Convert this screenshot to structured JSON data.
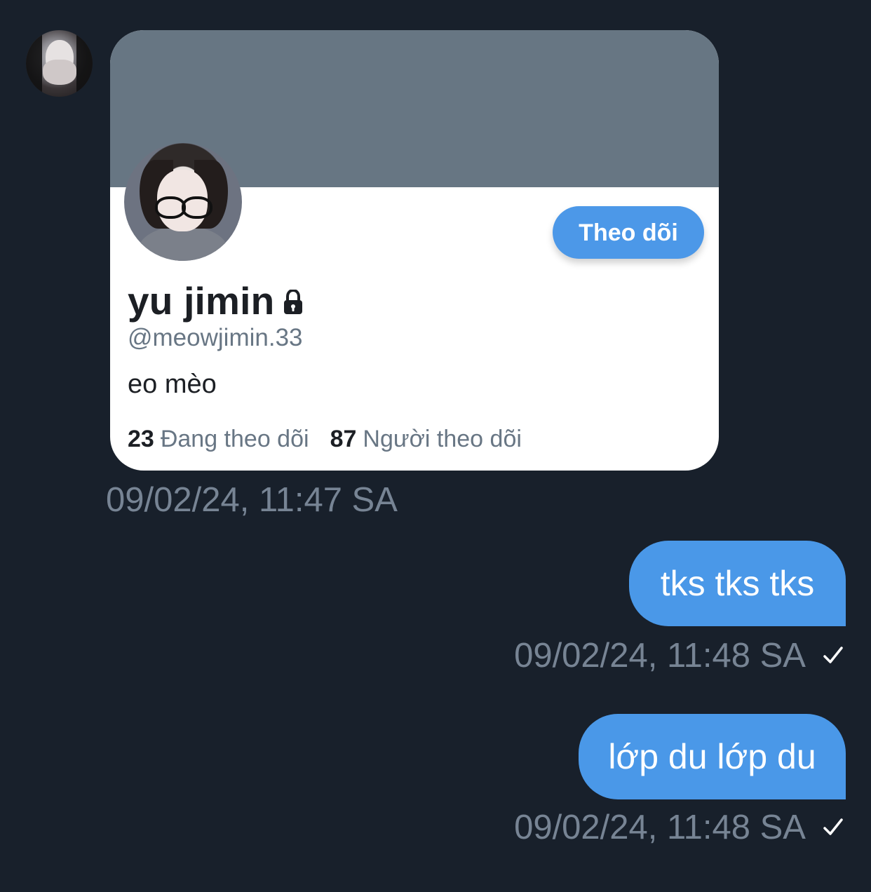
{
  "card": {
    "follow_label": "Theo dõi",
    "display_name": "yu jimin",
    "username": "@meowjimin.33",
    "bio": "eo mèo",
    "following_count": "23",
    "following_label": "Đang theo dõi",
    "followers_count": "87",
    "followers_label": "Người theo dõi"
  },
  "timestamps": {
    "card": "09/02/24, 11:47 SA",
    "message_1": "09/02/24, 11:48 SA",
    "message_2": "09/02/24, 11:48 SA"
  },
  "messages": [
    {
      "text": "tks tks tks"
    },
    {
      "text": "lớp du lớp du"
    }
  ],
  "icons": {
    "lock": "lock-icon",
    "check": "check-icon"
  },
  "colors": {
    "background": "#18202b",
    "banner": "#677683",
    "accent": "#4a98e8",
    "muted_text": "#778494"
  }
}
